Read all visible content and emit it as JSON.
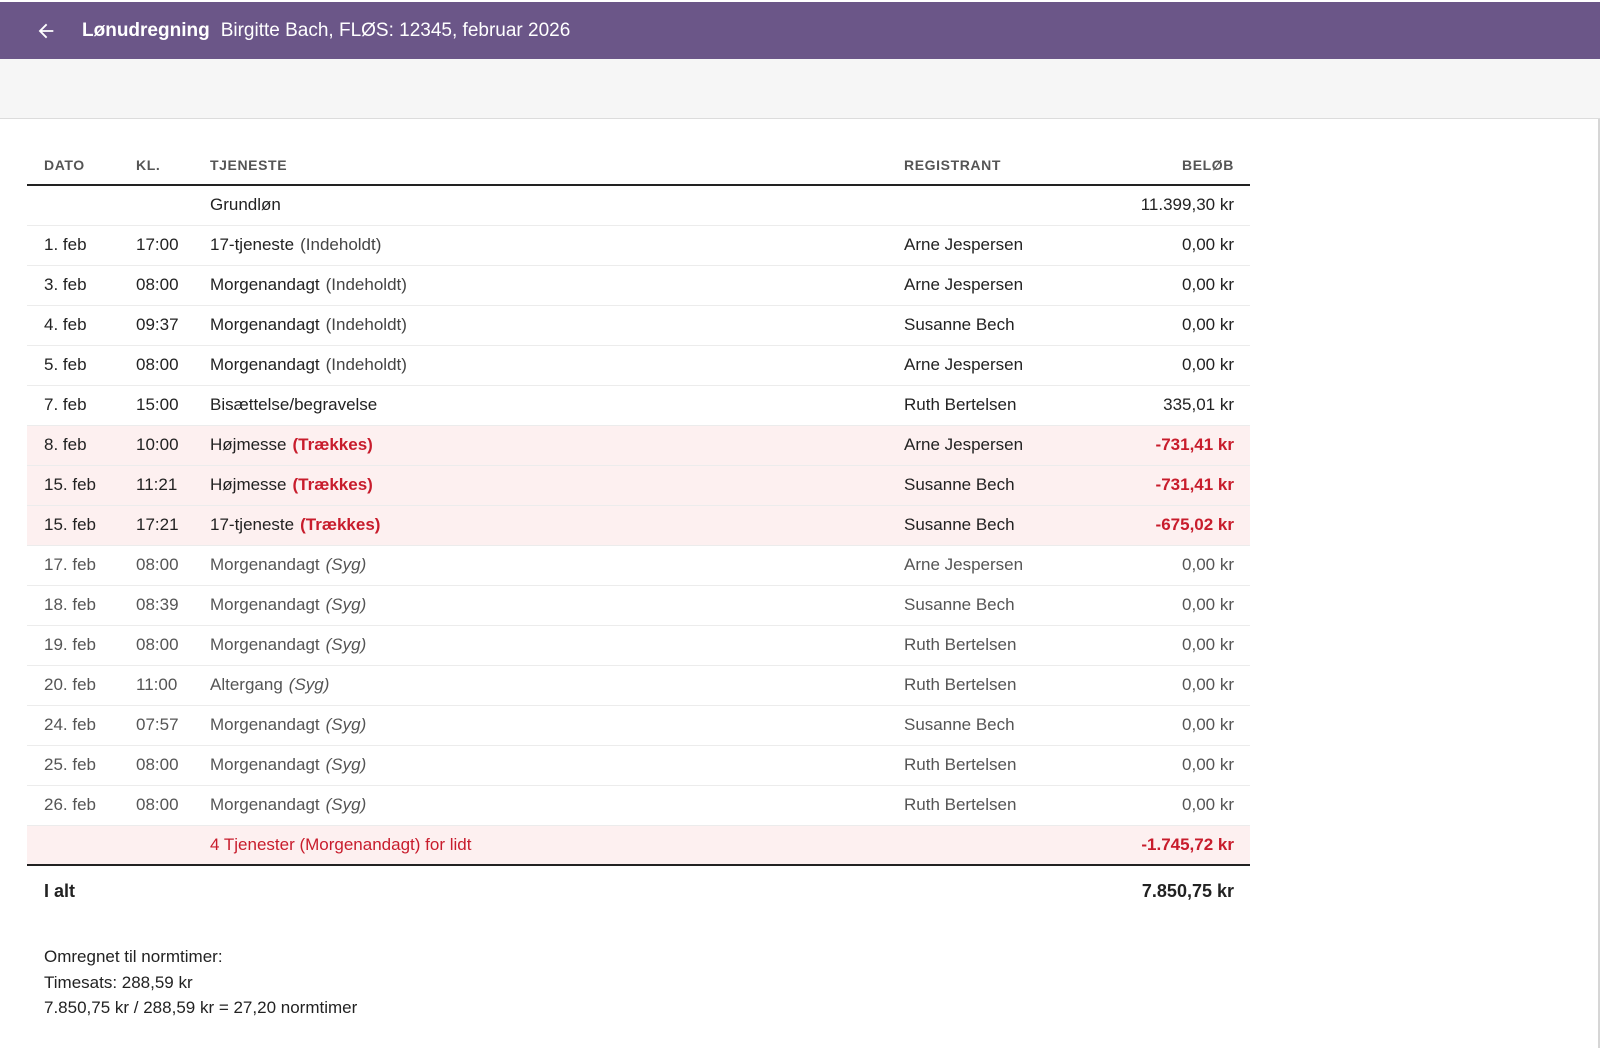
{
  "header": {
    "title": "Lønudregning",
    "subtitle": "Birgitte Bach, FLØS: 12345, februar 2026"
  },
  "table": {
    "headers": {
      "date": "DATO",
      "time": "KL.",
      "service": "TJENESTE",
      "registrant": "REGISTRANT",
      "amount": "BELØB"
    },
    "base": {
      "label": "Grundløn",
      "amount": "11.399,30 kr"
    },
    "rows": [
      {
        "date": "1. feb",
        "time": "17:00",
        "service": "17-tjeneste",
        "tag": "(Indeholdt)",
        "tag_type": "held",
        "registrant": "Arne Jespersen",
        "amount": "0,00 kr"
      },
      {
        "date": "3. feb",
        "time": "08:00",
        "service": "Morgenandagt",
        "tag": "(Indeholdt)",
        "tag_type": "held",
        "registrant": "Arne Jespersen",
        "amount": "0,00 kr"
      },
      {
        "date": "4. feb",
        "time": "09:37",
        "service": "Morgenandagt",
        "tag": "(Indeholdt)",
        "tag_type": "held",
        "registrant": "Susanne Bech",
        "amount": "0,00 kr"
      },
      {
        "date": "5. feb",
        "time": "08:00",
        "service": "Morgenandagt",
        "tag": "(Indeholdt)",
        "tag_type": "held",
        "registrant": "Arne Jespersen",
        "amount": "0,00 kr"
      },
      {
        "date": "7. feb",
        "time": "15:00",
        "service": "Bisættelse/begravelse",
        "tag": "",
        "tag_type": "none",
        "registrant": "Ruth Bertelsen",
        "amount": "335,01 kr"
      },
      {
        "date": "8. feb",
        "time": "10:00",
        "service": "Højmesse",
        "tag": "(Trækkes)",
        "tag_type": "deduct",
        "registrant": "Arne Jespersen",
        "amount": "-731,41 kr"
      },
      {
        "date": "15. feb",
        "time": "11:21",
        "service": "Højmesse",
        "tag": "(Trækkes)",
        "tag_type": "deduct",
        "registrant": "Susanne Bech",
        "amount": "-731,41 kr"
      },
      {
        "date": "15. feb",
        "time": "17:21",
        "service": "17-tjeneste",
        "tag": "(Trækkes)",
        "tag_type": "deduct",
        "registrant": "Susanne Bech",
        "amount": "-675,02 kr"
      },
      {
        "date": "17. feb",
        "time": "08:00",
        "service": "Morgenandagt",
        "tag": "(Syg)",
        "tag_type": "sick",
        "registrant": "Arne Jespersen",
        "amount": "0,00 kr"
      },
      {
        "date": "18. feb",
        "time": "08:39",
        "service": "Morgenandagt",
        "tag": "(Syg)",
        "tag_type": "sick",
        "registrant": "Susanne Bech",
        "amount": "0,00 kr"
      },
      {
        "date": "19. feb",
        "time": "08:00",
        "service": "Morgenandagt",
        "tag": "(Syg)",
        "tag_type": "sick",
        "registrant": "Ruth Bertelsen",
        "amount": "0,00 kr"
      },
      {
        "date": "20. feb",
        "time": "11:00",
        "service": "Altergang",
        "tag": "(Syg)",
        "tag_type": "sick",
        "registrant": "Ruth Bertelsen",
        "amount": "0,00 kr"
      },
      {
        "date": "24. feb",
        "time": "07:57",
        "service": "Morgenandagt",
        "tag": "(Syg)",
        "tag_type": "sick",
        "registrant": "Susanne Bech",
        "amount": "0,00 kr"
      },
      {
        "date": "25. feb",
        "time": "08:00",
        "service": "Morgenandagt",
        "tag": "(Syg)",
        "tag_type": "sick",
        "registrant": "Ruth Bertelsen",
        "amount": "0,00 kr"
      },
      {
        "date": "26. feb",
        "time": "08:00",
        "service": "Morgenandagt",
        "tag": "(Syg)",
        "tag_type": "sick",
        "registrant": "Ruth Bertelsen",
        "amount": "0,00 kr"
      }
    ],
    "shortfall": {
      "label": "4 Tjenester (Morgenandagt) for lidt",
      "amount": "-1.745,72 kr"
    },
    "total": {
      "label": "I alt",
      "amount": "7.850,75 kr"
    }
  },
  "notes": {
    "line1": "Omregnet til normtimer:",
    "line2": "Timesats: 288,59 kr",
    "line3": "7.850,75 kr / 288,59 kr = 27,20 normtimer"
  },
  "colors": {
    "appbar": "#6b5688",
    "deduct_text": "#c81c2c",
    "deduct_row_bg": "#fdf0f0"
  },
  "icons": {
    "back": "arrow-back-icon"
  }
}
